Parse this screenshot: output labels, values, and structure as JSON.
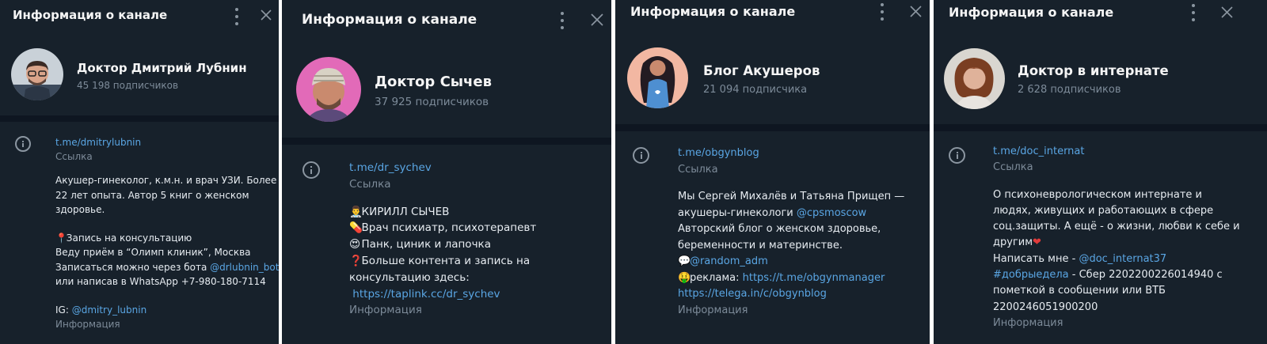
{
  "header_title": "Информация о канале",
  "link_caption": "Ссылка",
  "info_caption": "Информация",
  "colors": {
    "panel_bg": "#17212b",
    "divider": "#0e1621",
    "link": "#5aa6e4",
    "muted": "#7d8b99",
    "text": "#e7ecf1",
    "heart": "#e23b3b"
  },
  "icons": [
    "more-vertical-icon",
    "close-icon",
    "info-icon"
  ],
  "panels": [
    {
      "name": "Доктор Дмитрий Лубнин",
      "subscribers": "45 198 подписчиков",
      "link": "t.me/dmitrylubnin",
      "desc": {
        "l1": "Акушер-гинеколог, к.м.н. и врач УЗИ. Более",
        "l2": "22 лет опыта. Автор 5 книг о женском",
        "l3": "здоровье.",
        "l5": "Запись на консультацию",
        "l6": "Веду приём в “Олимп клиник”, Москва",
        "l7a": "Записаться можно через бота ",
        "l7b": "@drlubnin_bot",
        "l8": "или написав в WhatsApp +7-980-180-7114",
        "l10a": "IG: ",
        "l10b": "@dmitry_lubnin"
      }
    },
    {
      "name": "Доктор Сычев",
      "subscribers": "37 925 подписчиков",
      "link": "t.me/dr_sychev",
      "desc": {
        "l1": "КИРИЛЛ СЫЧЕВ",
        "l2": "Врач психиатр, психотерапевт",
        "l3": "Панк, циник и лапочка",
        "l4": "Больше контента и запись на",
        "l5": "консультацию здесь:",
        "l6": "https://taplink.cc/dr_sychev"
      }
    },
    {
      "name": "Блог Акушеров",
      "subscribers": "21 094 подписчика",
      "link": "t.me/obgynblog",
      "desc": {
        "l1": "Мы Сергей Михалёв и Татьяна Прищеп —",
        "l2a": "акушеры-гинекологи ",
        "l2b": "@cpsmoscow",
        "l3": "Авторский блог о женском здоровье,",
        "l4": "беременности и материнстве.",
        "l5": "@random_adm",
        "l6a": "реклама: ",
        "l6b": "https://t.me/obgynmanager",
        "l7": "https://telega.in/c/obgynblog"
      }
    },
    {
      "name": "Доктор в интернате",
      "subscribers": "2 628 подписчиков",
      "link": "t.me/doc_internat",
      "desc": {
        "l1": "О психоневрологическом интернате и",
        "l2": "людях, живущих и работающих в сфере",
        "l3": "соц.защиты. А ещё - о жизни, любви к себе и",
        "l4": "другим",
        "l5a": "Написать мне - ",
        "l5b": "@doc_internat37",
        "l6a": "#добрыедела",
        "l6b": " - Сбер 2202200226014940 с",
        "l7": "пометкой в сообщении или ВТБ",
        "l8": "2200246051900200"
      }
    }
  ]
}
